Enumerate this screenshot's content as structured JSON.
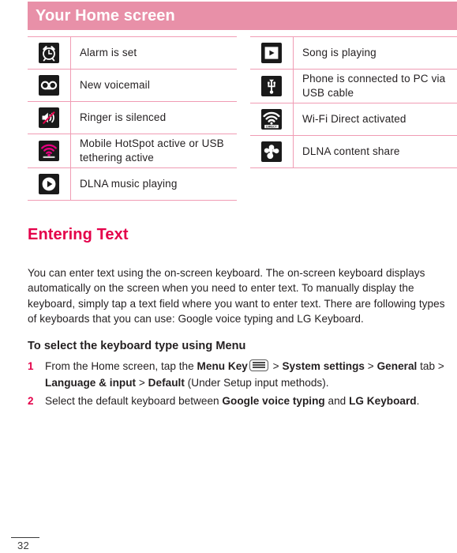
{
  "header": {
    "title": "Your Home screen",
    "band_color": "#e890a8"
  },
  "status_icon_tables": {
    "left": [
      {
        "icon": "alarm-clock-icon",
        "label": "Alarm is set"
      },
      {
        "icon": "voicemail-icon",
        "label": "New voicemail"
      },
      {
        "icon": "speaker-muted-icon",
        "label": "Ringer is silenced"
      },
      {
        "icon": "mobile-hotspot-icon",
        "label": "Mobile HotSpot active or USB tethering active"
      },
      {
        "icon": "dlna-music-play-icon",
        "label": "DLNA music playing"
      }
    ],
    "right": [
      {
        "icon": "music-play-icon",
        "label": "Song is playing"
      },
      {
        "icon": "usb-icon",
        "label": "Phone is connected to PC via USB cable"
      },
      {
        "icon": "wifi-direct-icon",
        "label": "Wi-Fi Direct activated",
        "icon_caption": "DIRECT"
      },
      {
        "icon": "dlna-share-icon",
        "label": "DLNA content share"
      }
    ]
  },
  "section": {
    "heading": "Entering Text",
    "heading_color": "#e4004a",
    "paragraph": "You can enter text using the on-screen keyboard. The on-screen keyboard displays automatically on the screen when you need to enter text. To manually display the keyboard, simply tap a text field where you want to enter text. There are following types of keyboards that you can use: Google voice typing and LG Keyboard."
  },
  "procedure": {
    "sub_heading": "To select the keyboard type using Menu",
    "steps": [
      {
        "number": "1",
        "parts": [
          {
            "text": "From the Home screen, tap the ",
            "bold": false
          },
          {
            "text": "Menu Key",
            "bold": true
          },
          {
            "text": "menu-key-icon",
            "icon": true
          },
          {
            "text": " > ",
            "bold": false
          },
          {
            "text": "System settings",
            "bold": true
          },
          {
            "text": " > ",
            "bold": false
          },
          {
            "text": "General",
            "bold": true
          },
          {
            "text": " tab > ",
            "bold": false
          },
          {
            "text": "Language & input",
            "bold": true
          },
          {
            "text": " > ",
            "bold": false
          },
          {
            "text": "Default",
            "bold": true
          },
          {
            "text": " (Under Setup input methods).",
            "bold": false
          }
        ]
      },
      {
        "number": "2",
        "parts": [
          {
            "text": "Select the default keyboard between ",
            "bold": false
          },
          {
            "text": "Google voice typing",
            "bold": true
          },
          {
            "text": " and ",
            "bold": false
          },
          {
            "text": "LG Keyboard",
            "bold": true
          },
          {
            "text": ".",
            "bold": false
          }
        ]
      }
    ]
  },
  "footer": {
    "page_number": "32"
  }
}
